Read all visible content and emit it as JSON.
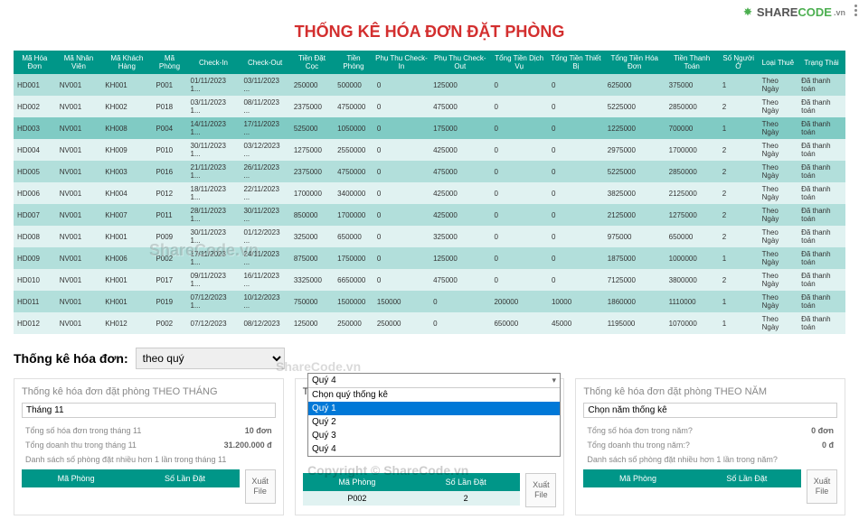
{
  "logo": {
    "share": "SHARE",
    "code": "CODE",
    "vn": ".vn"
  },
  "title": "THỐNG KÊ HÓA ĐƠN ĐẶT PHÒNG",
  "cols": [
    "Mã Hóa Đơn",
    "Mã Nhân Viên",
    "Mã Khách Hàng",
    "Mã Phòng",
    "Check-In",
    "Check-Out",
    "Tiền Đặt Cọc",
    "Tiền Phòng",
    "Phụ Thu Check-In",
    "Phụ Thu Check-Out",
    "Tổng Tiền Dịch Vụ",
    "Tổng Tiền Thiết Bị",
    "Tổng Tiền Hóa Đơn",
    "Tiền Thanh Toán",
    "Số Người Ở",
    "Loại Thuê",
    "Trạng Thái"
  ],
  "rows": [
    [
      "HD001",
      "NV001",
      "KH001",
      "P001",
      "01/11/2023 1...",
      "03/11/2023 ...",
      "250000",
      "500000",
      "0",
      "125000",
      "0",
      "0",
      "625000",
      "375000",
      "1",
      "Theo Ngày",
      "Đã thanh toán"
    ],
    [
      "HD002",
      "NV001",
      "KH002",
      "P018",
      "03/11/2023 1...",
      "08/11/2023 ...",
      "2375000",
      "4750000",
      "0",
      "475000",
      "0",
      "0",
      "5225000",
      "2850000",
      "2",
      "Theo Ngày",
      "Đã thanh toán"
    ],
    [
      "HD003",
      "NV001",
      "KH008",
      "P004",
      "14/11/2023 1...",
      "17/11/2023 ...",
      "525000",
      "1050000",
      "0",
      "175000",
      "0",
      "0",
      "1225000",
      "700000",
      "1",
      "Theo Ngày",
      "Đã thanh toán"
    ],
    [
      "HD004",
      "NV001",
      "KH009",
      "P010",
      "30/11/2023 1...",
      "03/12/2023 ...",
      "1275000",
      "2550000",
      "0",
      "425000",
      "0",
      "0",
      "2975000",
      "1700000",
      "2",
      "Theo Ngày",
      "Đã thanh toán"
    ],
    [
      "HD005",
      "NV001",
      "KH003",
      "P016",
      "21/11/2023 1...",
      "26/11/2023 ...",
      "2375000",
      "4750000",
      "0",
      "475000",
      "0",
      "0",
      "5225000",
      "2850000",
      "2",
      "Theo Ngày",
      "Đã thanh toán"
    ],
    [
      "HD006",
      "NV001",
      "KH004",
      "P012",
      "18/11/2023 1...",
      "22/11/2023 ...",
      "1700000",
      "3400000",
      "0",
      "425000",
      "0",
      "0",
      "3825000",
      "2125000",
      "2",
      "Theo Ngày",
      "Đã thanh toán"
    ],
    [
      "HD007",
      "NV001",
      "KH007",
      "P011",
      "28/11/2023 1...",
      "30/11/2023 ...",
      "850000",
      "1700000",
      "0",
      "425000",
      "0",
      "0",
      "2125000",
      "1275000",
      "2",
      "Theo Ngày",
      "Đã thanh toán"
    ],
    [
      "HD008",
      "NV001",
      "KH001",
      "P009",
      "30/11/2023 1...",
      "01/12/2023 ...",
      "325000",
      "650000",
      "0",
      "325000",
      "0",
      "0",
      "975000",
      "650000",
      "2",
      "Theo Ngày",
      "Đã thanh toán"
    ],
    [
      "HD009",
      "NV001",
      "KH006",
      "P002",
      "17/11/2023 1...",
      "24/11/2023 ...",
      "875000",
      "1750000",
      "0",
      "125000",
      "0",
      "0",
      "1875000",
      "1000000",
      "1",
      "Theo Ngày",
      "Đã thanh toán"
    ],
    [
      "HD010",
      "NV001",
      "KH001",
      "P017",
      "09/11/2023 1...",
      "16/11/2023 ...",
      "3325000",
      "6650000",
      "0",
      "475000",
      "0",
      "0",
      "7125000",
      "3800000",
      "2",
      "Theo Ngày",
      "Đã thanh toán"
    ],
    [
      "HD011",
      "NV001",
      "KH001",
      "P019",
      "07/12/2023 1...",
      "10/12/2023 ...",
      "750000",
      "1500000",
      "150000",
      "0",
      "200000",
      "10000",
      "1860000",
      "1110000",
      "1",
      "Theo Ngày",
      "Đã thanh toán"
    ],
    [
      "HD012",
      "NV001",
      "KH012",
      "P002",
      "07/12/2023",
      "08/12/2023",
      "125000",
      "250000",
      "250000",
      "0",
      "650000",
      "45000",
      "1195000",
      "1070000",
      "1",
      "Theo Ngày",
      "Đã thanh toán"
    ]
  ],
  "selected_row": 2,
  "filter": {
    "label": "Thống kê hóa đơn:",
    "value": "theo quý"
  },
  "panels": {
    "month": {
      "title": "Thống kê hóa đơn đặt phòng THEO THÁNG",
      "select": "Tháng 11",
      "r1l": "Tổng số hóa đơn trong tháng 11",
      "r1v": "10 đơn",
      "r2l": "Tổng doanh thu trong tháng 11",
      "r2v": "31.200.000 đ",
      "note": "Danh sách số phòng đặt nhiều hơn 1 lần trong tháng 11",
      "h1": "Mã Phòng",
      "h2": "Số Lần Đặt"
    },
    "quarter": {
      "title": "Thống kê hóa đơn đặt phòng THEO QUÝ",
      "select": "Quý 4",
      "options": [
        "Chọn quý thống kê",
        "Quý 1",
        "Quý 2",
        "Quý 3",
        "Quý 4"
      ],
      "hl": 1,
      "h1": "Mã Phòng",
      "h2": "Số Lần Đặt",
      "row": [
        "P002",
        "2"
      ]
    },
    "year": {
      "title": "Thống kê hóa đơn đặt phòng THEO NĂM",
      "select": "Chọn năm thống kê",
      "r1l": "Tổng số hóa đơn trong năm?",
      "r1v": "0 đơn",
      "r2l": "Tổng doanh thu trong năm:?",
      "r2v": "0 đ",
      "note": "Danh sách số phòng đặt nhiều hơn 1 lần trong năm?",
      "h1": "Mã Phòng",
      "h2": "Số Lần Đặt"
    }
  },
  "export": "Xuất File",
  "wm1": "ShareCode.vn",
  "wm2": "ShareCode.vn",
  "wm3": "Copyright © ShareCode.vn"
}
